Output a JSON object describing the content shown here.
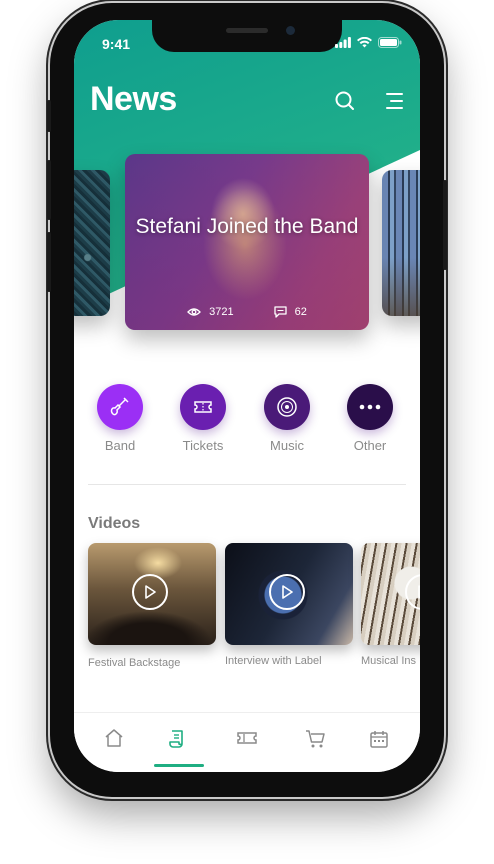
{
  "status": {
    "time": "9:41"
  },
  "header": {
    "title": "News"
  },
  "featured": {
    "title": "Stefani Joined the Band",
    "views": "3721",
    "comments": "62"
  },
  "categories": [
    {
      "label": "Band",
      "color": "#9b2ff5",
      "icon": "guitar-icon"
    },
    {
      "label": "Tickets",
      "color": "#6a1fb0",
      "icon": "ticket-icon"
    },
    {
      "label": "Music",
      "color": "#4a1a78",
      "icon": "vinyl-record-icon"
    },
    {
      "label": "Other",
      "color": "#2a0e4a",
      "icon": "more-dots-icon"
    }
  ],
  "videos_section": {
    "title": "Videos",
    "items": [
      {
        "label": "Festival Backstage"
      },
      {
        "label": "Interview with Label"
      },
      {
        "label": "Musical Ins"
      }
    ]
  },
  "nav": {
    "items": [
      "home-icon",
      "news-icon",
      "tickets-icon",
      "cart-icon",
      "calendar-icon"
    ],
    "active_index": 1,
    "accent": "#1fae82"
  },
  "colors": {
    "header_teal": "#16a38c",
    "label_gray": "#8a8a8a"
  }
}
